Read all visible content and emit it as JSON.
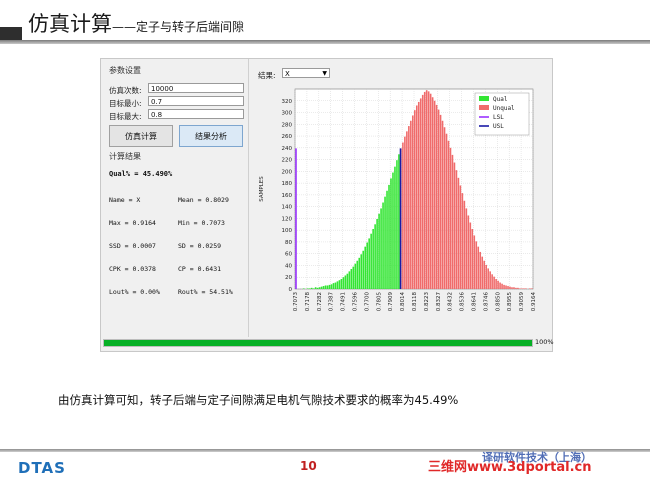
{
  "slide": {
    "title": "仿真计算",
    "subtitle": "——定子与转子后端间隙",
    "caption": "由仿真计算可知，转子后端与定子间隙满足电机气隙技术要求的概率为45.49%",
    "page_number": "10",
    "logo_text": "DTAS",
    "watermark": "三维网www.3dportal.cn",
    "watermark_partial": "译研软件技术（上海）"
  },
  "params": {
    "group_title": "参数设置",
    "sim_count_label": "仿真次数:",
    "sim_count_value": "10000",
    "target_min_label": "目标最小:",
    "target_min_value": "0.7",
    "target_max_label": "目标最大:",
    "target_max_value": "0.8",
    "simulate_button": "仿真计算",
    "analyze_button": "结果分析"
  },
  "results": {
    "group_title": "计算结果",
    "qual_line": "Qual% = 45.490%",
    "rows": [
      [
        "Name = X",
        "Mean = 0.8029"
      ],
      [
        "Max = 0.9164",
        "Min = 0.7073"
      ],
      [
        "SSD = 0.0007",
        "SD = 0.0259"
      ],
      [
        "CPK = 0.0378",
        "CP = 0.6431"
      ],
      [
        "Lout% = 0.00%",
        "Rout% = 54.51%"
      ]
    ]
  },
  "result_selector": {
    "label": "结果:",
    "value": "X"
  },
  "progress": {
    "value": 100,
    "text": "100%"
  },
  "colors": {
    "qual": "#33e533",
    "unqual": "#f06b6b",
    "lsl": "#9933ff",
    "usl": "#1a1aa6",
    "progress": "#06b025"
  },
  "chart_data": {
    "type": "bar",
    "title": "",
    "xlabel": "",
    "ylabel": "SAMPLES",
    "ylim": [
      0,
      340
    ],
    "yticks": [
      0,
      20,
      40,
      60,
      80,
      100,
      120,
      140,
      160,
      180,
      200,
      220,
      240,
      260,
      280,
      300,
      320
    ],
    "xlim": [
      0.7073,
      0.9164
    ],
    "xtick_labels": [
      "0.7073",
      "0.7178",
      "0.7282",
      "0.7387",
      "0.7491",
      "0.7596",
      "0.7700",
      "0.7805",
      "0.7909",
      "0.8014",
      "0.8118",
      "0.8223",
      "0.8327",
      "0.8432",
      "0.8536",
      "0.8641",
      "0.8746",
      "0.8850",
      "0.8955",
      "0.9059",
      "0.9164"
    ],
    "legend": [
      {
        "name": "Qual",
        "kind": "bar",
        "color": "#33e533"
      },
      {
        "name": "Unqual",
        "kind": "bar",
        "color": "#f06b6b"
      },
      {
        "name": "LSL",
        "kind": "line",
        "color": "#9933ff"
      },
      {
        "name": "USL",
        "kind": "line",
        "color": "#1a1aa6"
      }
    ],
    "legend_position": "top-right",
    "grid": true,
    "bins": {
      "start": 0.7073,
      "end": 0.9164,
      "count": 120,
      "values": [
        1,
        0,
        0,
        0,
        1,
        0,
        1,
        1,
        2,
        1,
        3,
        2,
        3,
        4,
        5,
        6,
        6,
        7,
        8,
        10,
        11,
        13,
        15,
        17,
        20,
        23,
        26,
        30,
        34,
        38,
        43,
        48,
        53,
        59,
        65,
        72,
        79,
        86,
        94,
        102,
        110,
        119,
        128,
        137,
        147,
        157,
        167,
        177,
        188,
        198,
        208,
        219,
        229,
        239,
        249,
        259,
        268,
        277,
        286,
        295,
        304,
        312,
        318,
        324,
        330,
        335,
        338,
        336,
        332,
        326,
        320,
        313,
        305,
        296,
        286,
        275,
        264,
        252,
        240,
        228,
        215,
        202,
        189,
        176,
        163,
        150,
        137,
        125,
        113,
        102,
        91,
        81,
        72,
        63,
        55,
        48,
        41,
        35,
        30,
        25,
        21,
        17,
        14,
        11,
        9,
        7,
        6,
        5,
        4,
        3,
        3,
        2,
        2,
        1,
        1,
        1,
        1,
        0,
        1,
        1
      ]
    },
    "lsl": {
      "x": 0.7,
      "height": 239
    },
    "usl": {
      "x": 0.8,
      "height": 239
    },
    "qual_range": [
      0.7,
      0.8
    ]
  }
}
